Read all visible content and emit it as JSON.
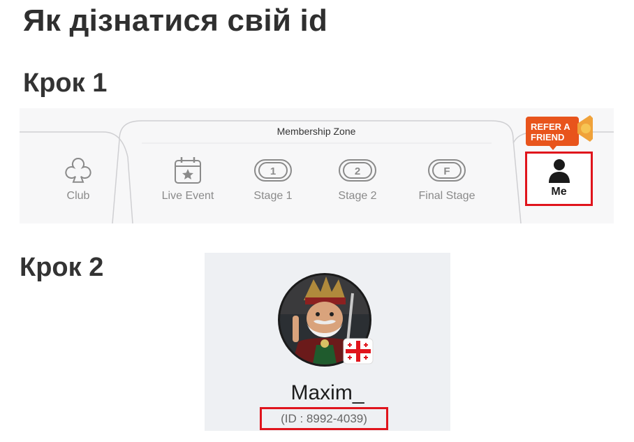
{
  "title": "Як дізнатися свій id",
  "steps": [
    {
      "label": "Крок 1"
    },
    {
      "label": "Крок 2"
    }
  ],
  "tabbar": {
    "zone_label": "Membership Zone",
    "tabs": [
      {
        "label": "Club",
        "icon": "club-icon"
      },
      {
        "label": "Live Event",
        "icon": "calendar-star-icon"
      },
      {
        "label": "Stage 1",
        "icon": "stage-1-icon"
      },
      {
        "label": "Stage 2",
        "icon": "stage-2-icon"
      },
      {
        "label": "Final Stage",
        "icon": "final-stage-icon"
      },
      {
        "label": "Me",
        "icon": "person-icon",
        "highlighted": true
      }
    ],
    "refer_badge": {
      "line1": "REFER A",
      "line2": "FRIEND"
    }
  },
  "profile": {
    "username": "Maxim_",
    "id_text": "(ID : 8992-4039)",
    "flag": "georgia-flag"
  },
  "colors": {
    "highlight": "#e0141c",
    "badge": "#e8541c",
    "card_bg": "#eef0f3"
  }
}
